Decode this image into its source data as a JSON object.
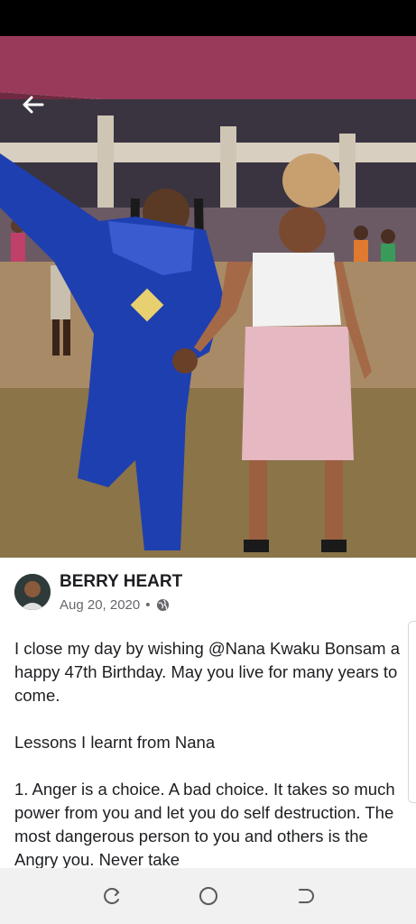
{
  "post": {
    "author": "BERRY HEART",
    "date": "Aug 20, 2020",
    "separator": "•",
    "privacy_icon": "globe-icon",
    "paragraphs": [
      "I close my day by wishing @Nana Kwaku Bonsam a happy 47th Birthday. May you live for many years to come.",
      "Lessons I learnt from Nana",
      "1. Anger is a choice. A bad choice. It takes so much power from you and let you do self destruction. The most dangerous person to you and others is the Angry you. Never take"
    ]
  },
  "icons": {
    "back": "back-arrow-icon",
    "recents": "recents-icon",
    "home": "home-icon",
    "back_nav": "back-nav-icon"
  },
  "colors": {
    "status_bar": "#000000",
    "nav_bar": "#f1f1f1",
    "author_text": "#1c1e21",
    "meta_text": "#65676b"
  }
}
